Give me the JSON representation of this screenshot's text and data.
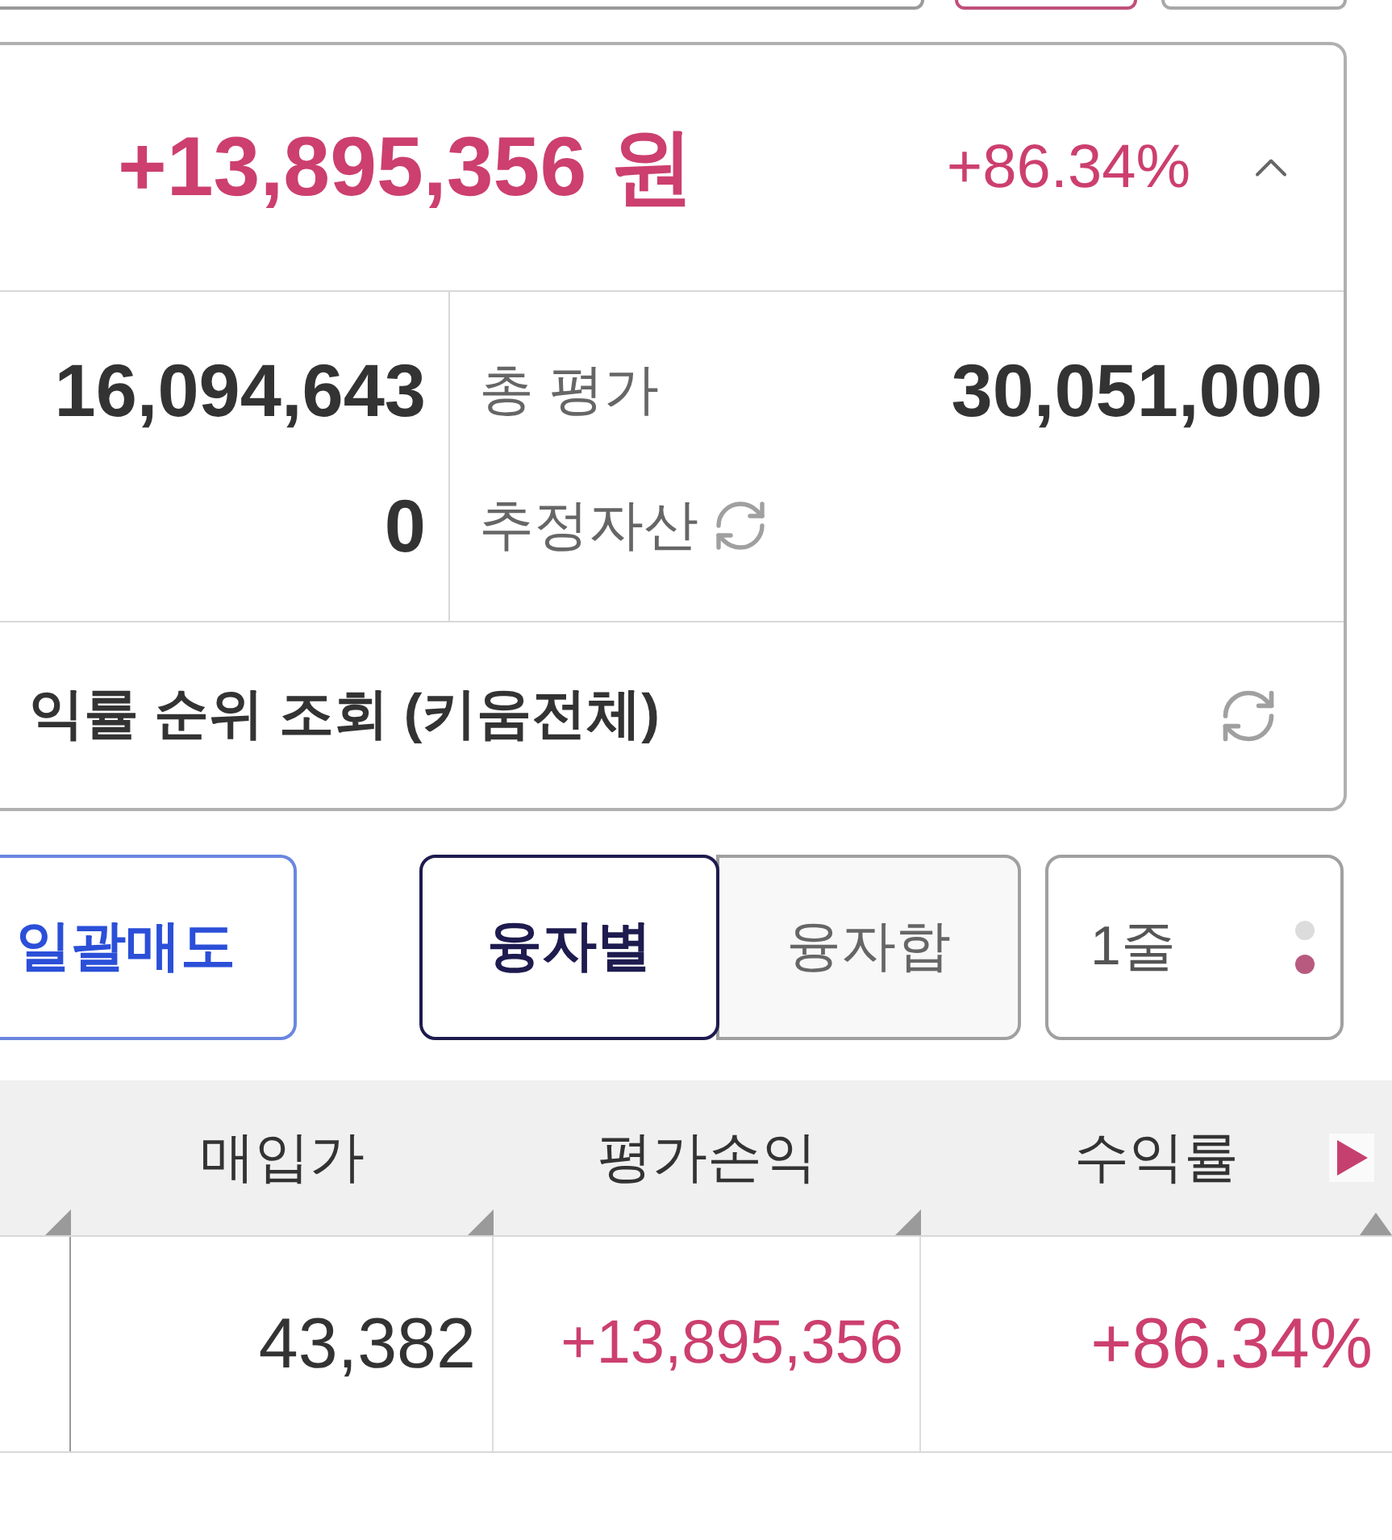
{
  "top_row": [
    {
      "kind": "field"
    },
    {
      "kind": "button",
      "selected": true
    },
    {
      "kind": "button",
      "selected": false
    }
  ],
  "summary": {
    "profit": "+13,895,356 원",
    "rate": "+86.34%",
    "expanded": true
  },
  "details": {
    "left_values": [
      "16,094,643",
      "0"
    ],
    "right_items": [
      {
        "kind": "value",
        "label": "총 평가",
        "value": "30,051,000"
      },
      {
        "kind": "refresh",
        "label": "추정자산"
      }
    ]
  },
  "ranking": {
    "label": "익률 순위 조회 (키움전체)"
  },
  "toolbar": {
    "sell_all": "일괄매도",
    "loan_view": [
      {
        "label": "융자별",
        "selected": true
      },
      {
        "label": "융자합",
        "selected": false
      }
    ],
    "line_view": {
      "label": "1줄",
      "dots": [
        {
          "selected": false
        },
        {
          "selected": true
        }
      ]
    }
  },
  "table": {
    "columns": [
      {
        "label": "매입가"
      },
      {
        "label": "평가손익"
      },
      {
        "label": "수익률"
      }
    ],
    "rows": [
      {
        "purchase_price": "43,382",
        "profit": "+13,895,356",
        "rate": "+86.34%"
      }
    ]
  }
}
